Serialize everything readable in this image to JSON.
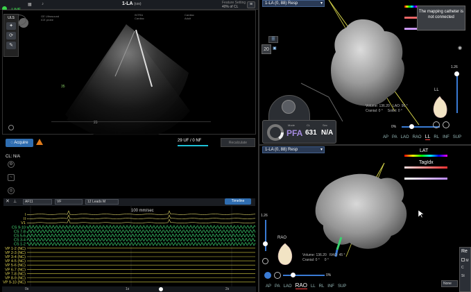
{
  "topbar": {
    "live": "LIVE",
    "title": "1-LA",
    "title_sub": "(rzo)",
    "feature_info": "40% of CL",
    "menu_icon": "hamburger-icon"
  },
  "us": {
    "scale_label": "35",
    "depth_label": "20"
  },
  "acquire": {
    "label": "Acquire"
  },
  "counts": {
    "text": "29 UF / 0 NF"
  },
  "recalc": {
    "label": "Recalculate"
  },
  "cl": {
    "label": "CL: N/A"
  },
  "ecg": {
    "sel1": "AF11",
    "sel2": "VF",
    "sel3": "12 Leads M",
    "timeline_btn": "Timeline",
    "speed": "100 mm/sec",
    "leads": [
      "I",
      "II",
      "V1",
      "CS 9-10",
      "CS 7-8",
      "CS 5-6",
      "CS 3-4",
      "CS 1-2",
      "VP 1-2 (NC)",
      "VP 2-3 (NC)",
      "VP 3-4 (NC)",
      "VP 4-5 (NC)",
      "VP 5-6 (NC)",
      "VP 6-7 (NC)",
      "VP 7-8 (NC)",
      "VP 8-9 (NC)",
      "VP 9-10 (NC)"
    ],
    "time_ticks": [
      "0s",
      "1s",
      "2s"
    ]
  },
  "map_top": {
    "header": "1-LA (0, 88) Resp",
    "volume_label": "Volume:",
    "volume": "136.20",
    "lao_label": "LAO:",
    "lao": "90 °",
    "cranial_label": "Cranial:",
    "cranial": "0 °",
    "solist_label": "Solist:",
    "solist": "0 °",
    "zoom": "1.26",
    "view_label": "LL",
    "pct": "0%",
    "views": [
      "AP",
      "PA",
      "LAO",
      "RAO",
      "LL",
      "RL",
      "INF",
      "SUP"
    ],
    "active_view": "LL"
  },
  "tooltip": {
    "text": "The mapping catheter is not connected"
  },
  "pfa": {
    "mode_label": "Mode",
    "mode": "PFA",
    "cl_label": "CL",
    "cl": "631",
    "sec_label": "Sec",
    "sec": "N/A"
  },
  "legend": {
    "lat": "LAT",
    "tag": "TagIdx"
  },
  "map_bottom": {
    "header": "1-LA (0, 88) Resp",
    "volume_label": "Volume:",
    "volume": "136.20",
    "rao_label": "RAO:",
    "rao": "45 °",
    "cranial_label": "Cranial:",
    "cranial": "0 °",
    "solist": "0 °",
    "zoom": "1.26",
    "view_label": "RAO",
    "pct": "0%",
    "views": [
      "AP",
      "PA",
      "LAO",
      "RAO",
      "LL",
      "RL",
      "INF",
      "SUP"
    ],
    "active_view": "RAO"
  },
  "res_panel": {
    "title": "Re",
    "m_label": "M",
    "c_label": "C",
    "none_label": "None",
    "st_label": "St"
  },
  "colors": {
    "accent": "#2f6db0",
    "ecg_green": "#3bd16f",
    "ecg_yellow": "#d8d043",
    "live": "#3ad34a"
  }
}
